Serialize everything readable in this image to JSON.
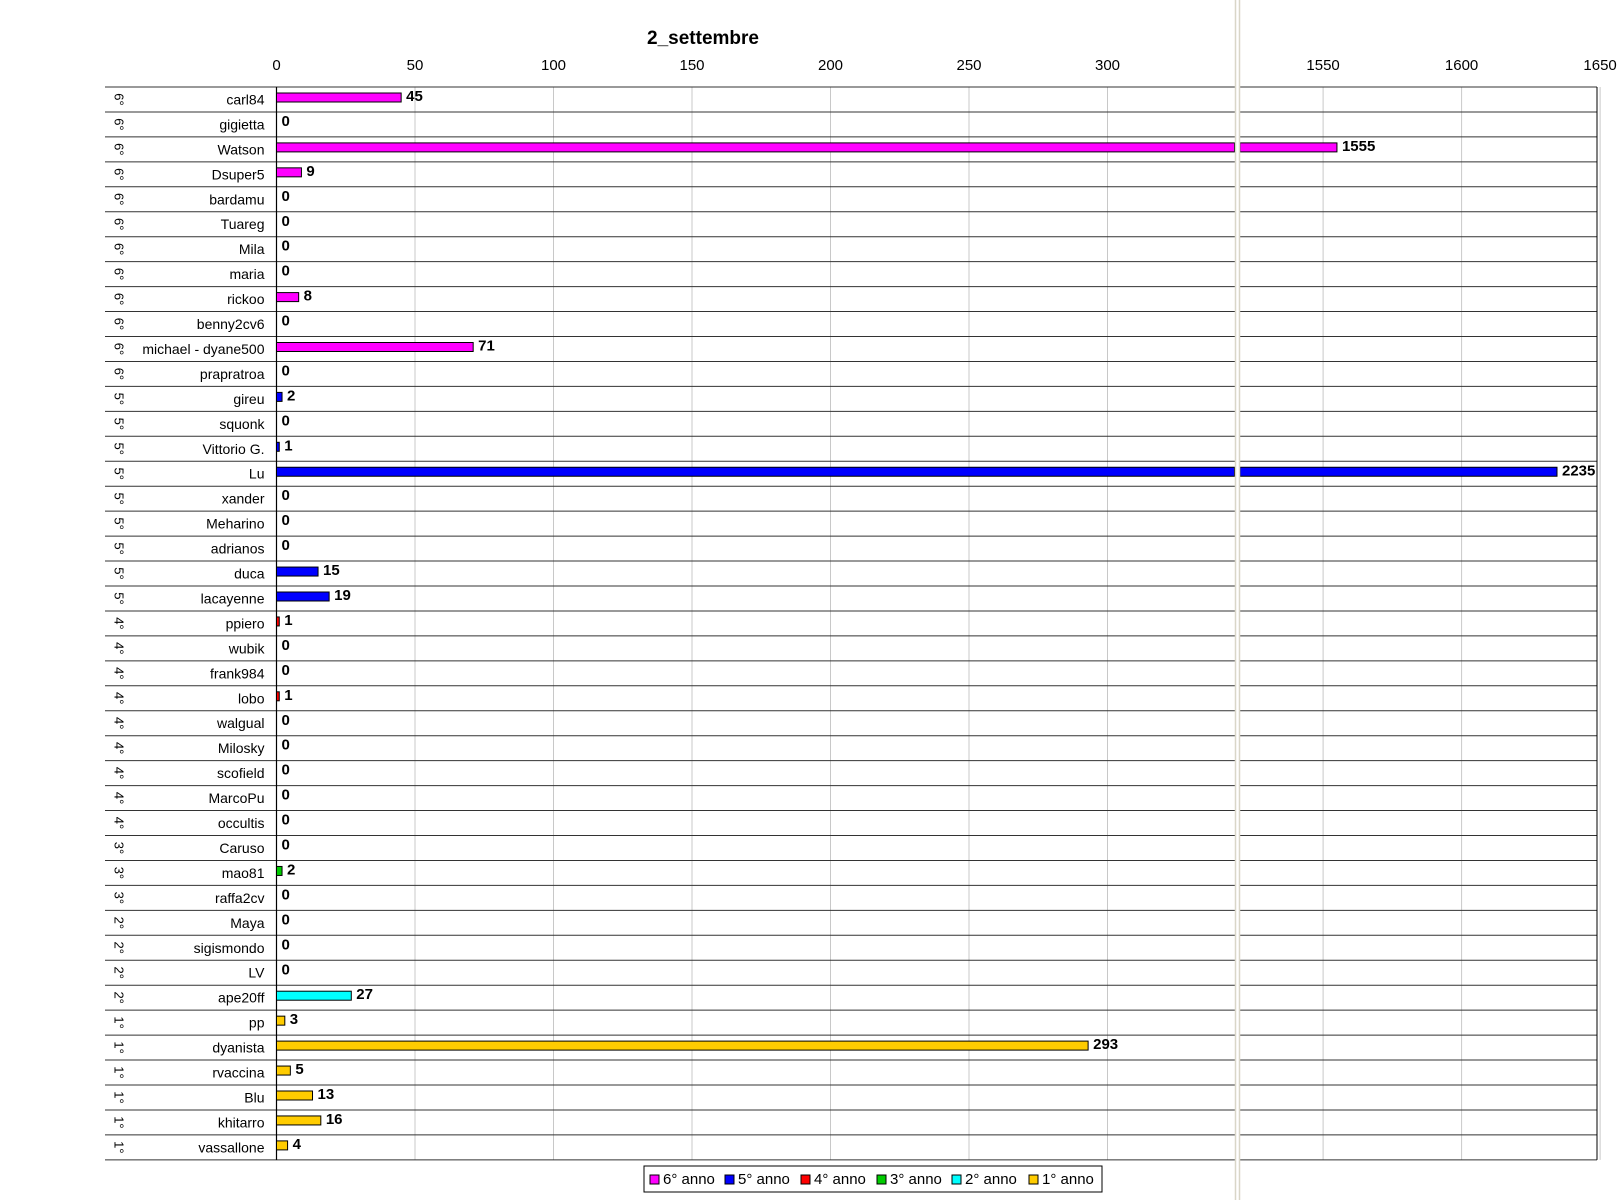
{
  "chart_data": {
    "type": "bar",
    "orientation": "horizontal",
    "title": "2_settembre",
    "xlabel": "",
    "ylabel": "",
    "axis_break": {
      "from": 345,
      "to": 1520
    },
    "xlim": [
      0,
      1650
    ],
    "x_ticks": [
      "0",
      "50",
      "100",
      "150",
      "200",
      "250",
      "300",
      "1550",
      "1600",
      "1650"
    ],
    "legend_position": "bottom",
    "groups": [
      {
        "key": "6",
        "label": "6°",
        "legend": "6° anno",
        "color": "#ff00ff"
      },
      {
        "key": "5",
        "label": "5°",
        "legend": "5° anno",
        "color": "#0000ff"
      },
      {
        "key": "4",
        "label": "4°",
        "legend": "4° anno",
        "color": "#ff0000"
      },
      {
        "key": "3",
        "label": "3°",
        "legend": "3° anno",
        "color": "#00cc00"
      },
      {
        "key": "2",
        "label": "2°",
        "legend": "2° anno",
        "color": "#00ffff"
      },
      {
        "key": "1",
        "label": "1°",
        "legend": "1° anno",
        "color": "#ffcc00"
      }
    ],
    "rows": [
      {
        "name": "carl84",
        "year": "6",
        "value": 45
      },
      {
        "name": "gigietta",
        "year": "6",
        "value": 0
      },
      {
        "name": "Watson",
        "year": "6",
        "value": 1555
      },
      {
        "name": "Dsuper5",
        "year": "6",
        "value": 9
      },
      {
        "name": "bardamu",
        "year": "6",
        "value": 0
      },
      {
        "name": "Tuareg",
        "year": "6",
        "value": 0
      },
      {
        "name": "Mila",
        "year": "6",
        "value": 0
      },
      {
        "name": "maria",
        "year": "6",
        "value": 0
      },
      {
        "name": "rickoo",
        "year": "6",
        "value": 8
      },
      {
        "name": "benny2cv6",
        "year": "6",
        "value": 0
      },
      {
        "name": "michael - dyane500",
        "year": "6",
        "value": 71
      },
      {
        "name": "prapratroa",
        "year": "6",
        "value": 0
      },
      {
        "name": "gireu",
        "year": "5",
        "value": 2
      },
      {
        "name": "squonk",
        "year": "5",
        "value": 0
      },
      {
        "name": "Vittorio G.",
        "year": "5",
        "value": 1
      },
      {
        "name": "Lu",
        "year": "5",
        "value": 2235
      },
      {
        "name": "xander",
        "year": "5",
        "value": 0
      },
      {
        "name": "Meharino",
        "year": "5",
        "value": 0
      },
      {
        "name": "adrianos",
        "year": "5",
        "value": 0
      },
      {
        "name": "duca",
        "year": "5",
        "value": 15
      },
      {
        "name": "lacayenne",
        "year": "5",
        "value": 19
      },
      {
        "name": "ppiero",
        "year": "4",
        "value": 1
      },
      {
        "name": "wubik",
        "year": "4",
        "value": 0
      },
      {
        "name": "frank984",
        "year": "4",
        "value": 0
      },
      {
        "name": "lobo",
        "year": "4",
        "value": 1
      },
      {
        "name": "walgual",
        "year": "4",
        "value": 0
      },
      {
        "name": "Milosky",
        "year": "4",
        "value": 0
      },
      {
        "name": "scofield",
        "year": "4",
        "value": 0
      },
      {
        "name": "MarcoPu",
        "year": "4",
        "value": 0
      },
      {
        "name": "occultis",
        "year": "4",
        "value": 0
      },
      {
        "name": "Caruso",
        "year": "3",
        "value": 0
      },
      {
        "name": "mao81",
        "year": "3",
        "value": 2
      },
      {
        "name": "raffa2cv",
        "year": "3",
        "value": 0
      },
      {
        "name": "Maya",
        "year": "2",
        "value": 0
      },
      {
        "name": "sigismondo",
        "year": "2",
        "value": 0
      },
      {
        "name": "LV",
        "year": "2",
        "value": 0
      },
      {
        "name": "ape20ff",
        "year": "2",
        "value": 27
      },
      {
        "name": "pp",
        "year": "1",
        "value": 3
      },
      {
        "name": "dyanista",
        "year": "1",
        "value": 293
      },
      {
        "name": "rvaccina",
        "year": "1",
        "value": 5
      },
      {
        "name": "Blu",
        "year": "1",
        "value": 13
      },
      {
        "name": "khitarro",
        "year": "1",
        "value": 16
      },
      {
        "name": "vassallone",
        "year": "1",
        "value": 4
      }
    ]
  }
}
